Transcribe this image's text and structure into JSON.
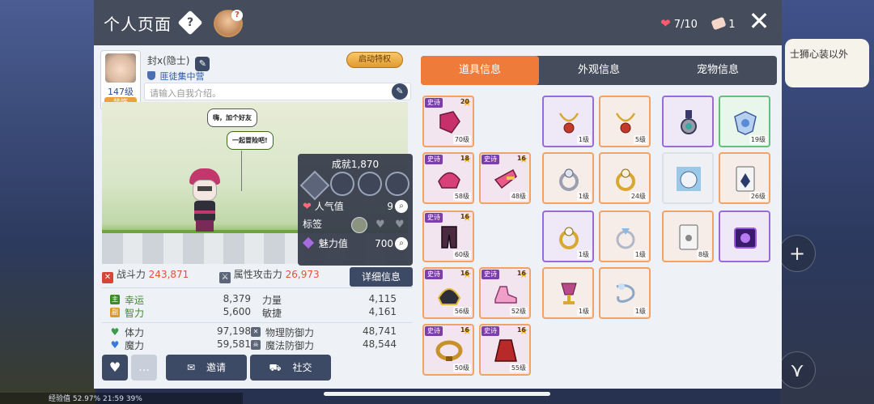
{
  "bg": {
    "speech_text": "士狮心装以外",
    "status_text": "经验值 52.97%  21:59  39%",
    "plus_glyph": "+",
    "right_arrow_glyph": "⋎"
  },
  "header": {
    "title": "个人页面",
    "help_glyph": "?",
    "hearts": "7/10",
    "tickets": "1",
    "close_glyph": "✕"
  },
  "profile": {
    "level": "147级",
    "avatar_tag": "装饰",
    "name": "封x(隐士)",
    "guild": "匪徒集中营",
    "privilege_button": "启动特权",
    "intro_placeholder": "请输入自我介绍。",
    "edit_glyph": "✎",
    "speech1": "嗨，加个好友",
    "speech2": "一起冒险吧!"
  },
  "achievements": {
    "title": "成就1,870",
    "popularity_label": "人气值",
    "popularity_value": "9",
    "tag_label": "标签",
    "charm_label": "魅力值",
    "charm_value": "700",
    "search_glyph": "🔍"
  },
  "stats": {
    "combat_power_label": "战斗力",
    "combat_power_value": "243,871",
    "attr_attack_label": "属性攻击力",
    "attr_attack_value": "26,973",
    "detail_button": "详细信息",
    "luck_label": "幸运",
    "luck_value": "8,379",
    "str_label": "力量",
    "str_value": "4,115",
    "int_label": "智力",
    "int_value": "5,600",
    "dex_label": "敏捷",
    "dex_value": "4,161",
    "hp_label": "体力",
    "hp_value": "97,198",
    "pdef_label": "物理防御力",
    "pdef_value": "48,741",
    "mp_label": "魔力",
    "mp_value": "59,581",
    "mdef_label": "魔法防御力",
    "mdef_value": "48,544"
  },
  "buttons": {
    "invite": "邀请",
    "social": "社交"
  },
  "tabs": [
    "道具信息",
    "外观信息",
    "宠物信息"
  ],
  "items": {
    "epic_label": "史诗",
    "e1_star": "20",
    "e1_lvl": "70级",
    "e2_star": "18",
    "e2_lvl": "58级",
    "e3_star": "16",
    "e3_lvl": "48级",
    "e4_star": "16",
    "e4_lvl": "60级",
    "e5_star": "16",
    "e5_lvl": "56级",
    "e6_star": "16",
    "e6_lvl": "52级",
    "e7_star": "16",
    "e7_lvl": "50级",
    "e8_star": "16",
    "e8_lvl": "55级",
    "a1_lvl": "1级",
    "a2_lvl": "5级",
    "a4_lvl": "19级",
    "a5_lvl": "1级",
    "a6_lvl": "24级",
    "a8_lvl": "26级",
    "a9_lvl": "1级",
    "a10_lvl": "1级",
    "a11_lvl": "8级",
    "a13_lvl": "1级",
    "a14_lvl": "1级"
  }
}
